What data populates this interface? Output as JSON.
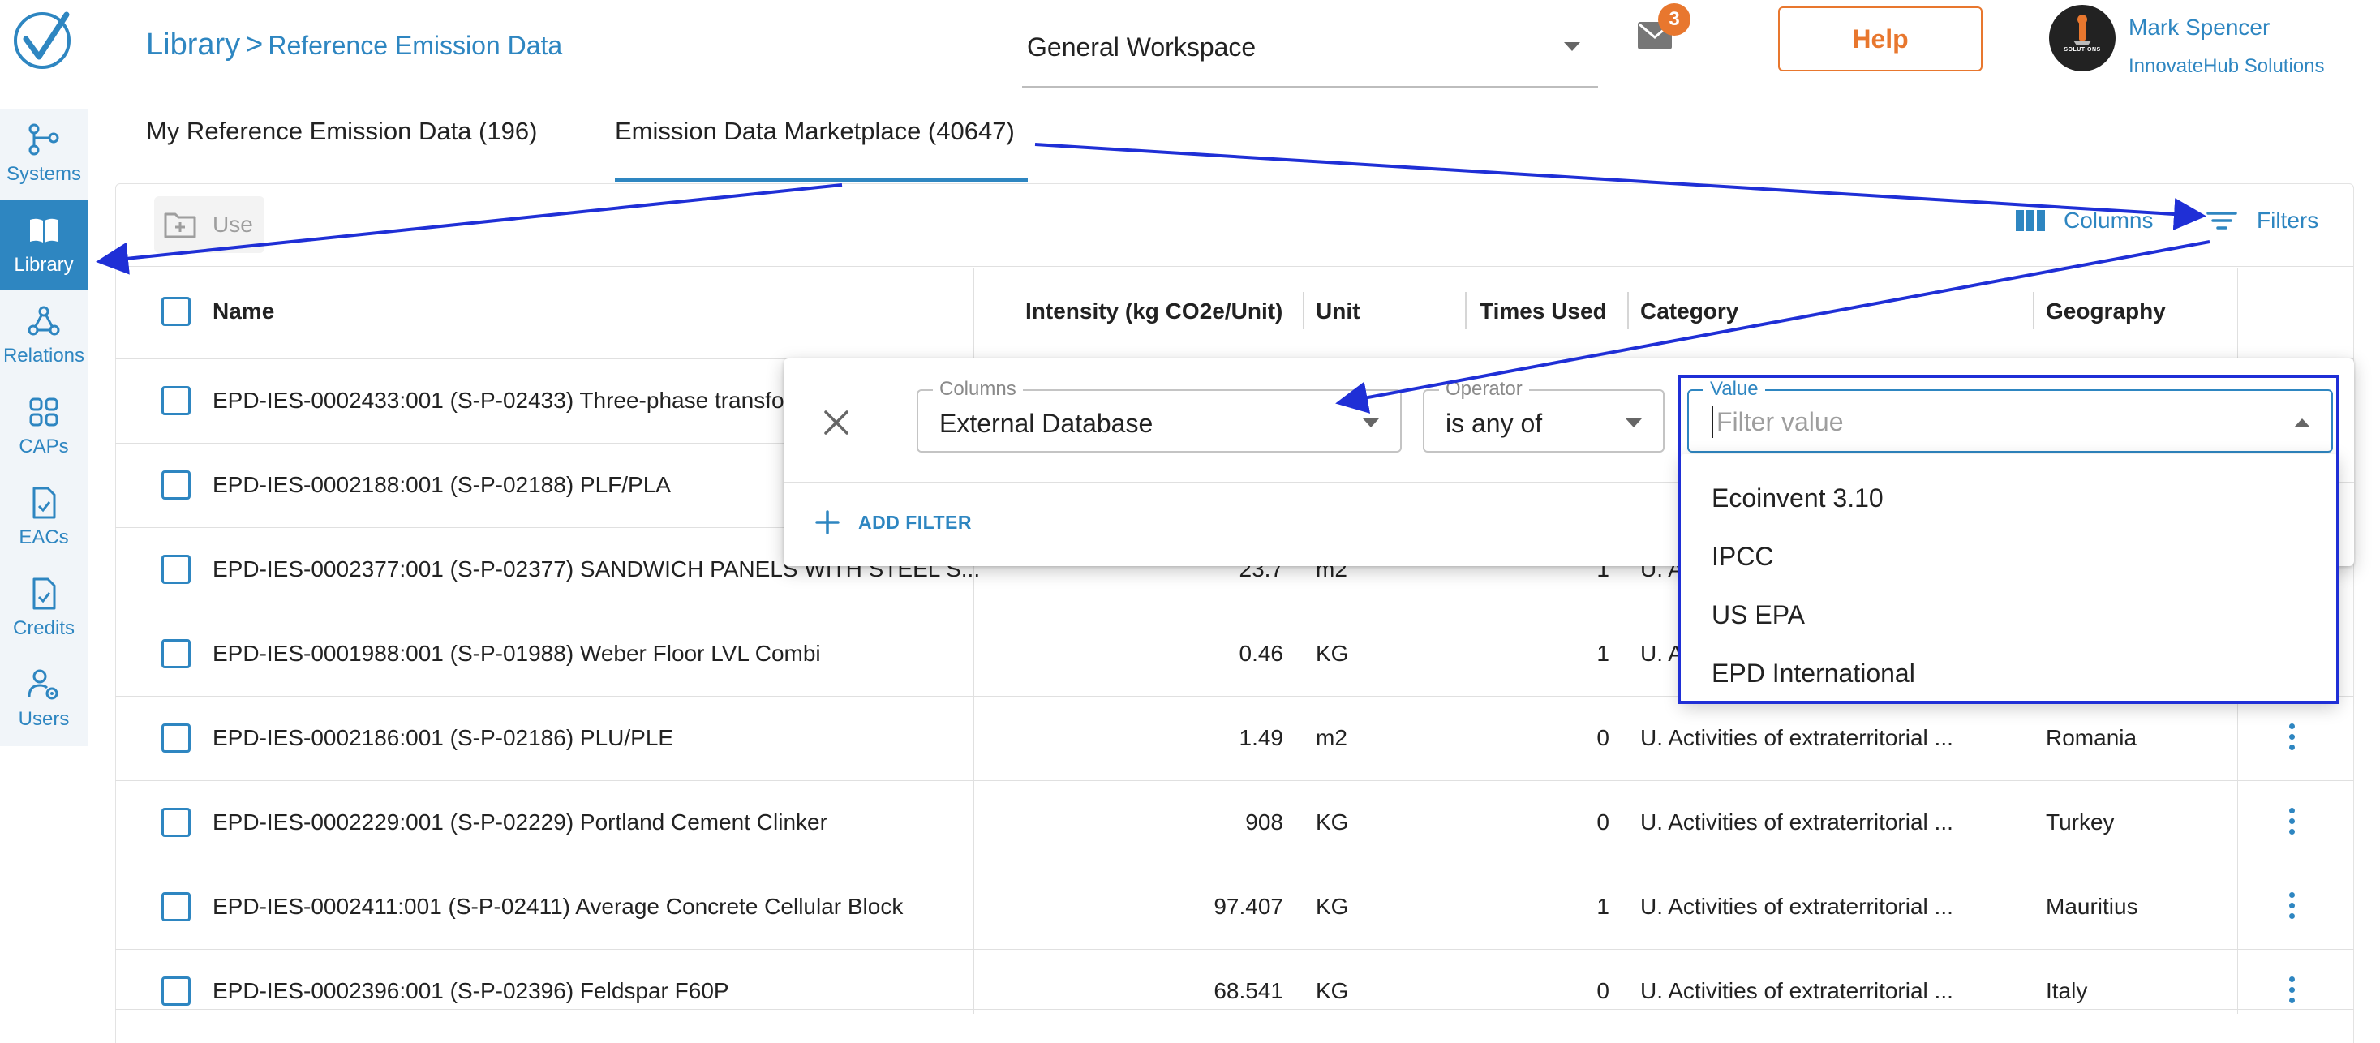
{
  "header": {
    "breadcrumb_root": "Library",
    "breadcrumb_separator": ">",
    "breadcrumb_page": "Reference Emission Data",
    "workspace": "General Workspace",
    "mail_count": "3",
    "help_label": "Help",
    "avatar_text": "SOLUTIONS",
    "user_name": "Mark Spencer",
    "user_org": "InnovateHub Solutions"
  },
  "sidebar": {
    "items": [
      {
        "label": "Systems",
        "icon": "systems-icon"
      },
      {
        "label": "Library",
        "icon": "book-icon",
        "active": true
      },
      {
        "label": "Relations",
        "icon": "relations-icon"
      },
      {
        "label": "CAPs",
        "icon": "grid-icon"
      },
      {
        "label": "EACs",
        "icon": "document-check-icon"
      },
      {
        "label": "Credits",
        "icon": "document-check-icon"
      },
      {
        "label": "Users",
        "icon": "users-gear-icon"
      }
    ],
    "accent": "#2e86c1"
  },
  "tabs": [
    {
      "label": "My Reference Emission Data (196)"
    },
    {
      "label": "Emission Data Marketplace (40647)",
      "active": true
    }
  ],
  "toolbar": {
    "use_label": "Use",
    "columns_label": "Columns",
    "filters_label": "Filters"
  },
  "table": {
    "columns": [
      "Name",
      "Intensity (kg CO2e/Unit)",
      "Unit",
      "Times Used",
      "Category",
      "Geography"
    ],
    "rows": [
      {
        "name": "EPD-IES-0002433:001 (S-P-02433) Three-phase transfor",
        "intensity": "",
        "unit": "",
        "times_used": "",
        "category": "",
        "geography": ""
      },
      {
        "name": "EPD-IES-0002188:001 (S-P-02188) PLF/PLA",
        "intensity": "",
        "unit": "",
        "times_used": "",
        "category": "",
        "geography": ""
      },
      {
        "name": "EPD-IES-0002377:001 (S-P-02377) SANDWICH PANELS WITH STEEL S...",
        "intensity": "23.7",
        "unit": "m2",
        "times_used": "1",
        "category": "U. A",
        "geography": ""
      },
      {
        "name": "EPD-IES-0001988:001 (S-P-01988) Weber Floor LVL Combi",
        "intensity": "0.46",
        "unit": "KG",
        "times_used": "1",
        "category": "U. A",
        "geography": ""
      },
      {
        "name": "EPD-IES-0002186:001 (S-P-02186) PLU/PLE",
        "intensity": "1.49",
        "unit": "m2",
        "times_used": "0",
        "category": "U. Activities of extraterritorial ...",
        "geography": "Romania"
      },
      {
        "name": "EPD-IES-0002229:001 (S-P-02229) Portland Cement Clinker",
        "intensity": "908",
        "unit": "KG",
        "times_used": "0",
        "category": "U. Activities of extraterritorial ...",
        "geography": "Turkey"
      },
      {
        "name": "EPD-IES-0002411:001 (S-P-02411) Average Concrete Cellular Block",
        "intensity": "97.407",
        "unit": "KG",
        "times_used": "1",
        "category": "U. Activities of extraterritorial ...",
        "geography": "Mauritius"
      },
      {
        "name": "EPD-IES-0002396:001 (S-P-02396) Feldspar F60P",
        "intensity": "68.541",
        "unit": "KG",
        "times_used": "0",
        "category": "U. Activities of extraterritorial ...",
        "geography": "Italy"
      }
    ]
  },
  "filter": {
    "columns_label": "Columns",
    "columns_value": "External Database",
    "operator_label": "Operator",
    "operator_value": "is any of",
    "value_label": "Value",
    "value_placeholder": "Filter value",
    "add_filter_label": "ADD FILTER",
    "options": [
      "Ecoinvent 3.10",
      "IPCC",
      "US EPA",
      "EPD International"
    ]
  },
  "colors": {
    "accent": "#2e86c1",
    "help_orange": "#e8772e",
    "annotation_blue": "#1f2fd6"
  }
}
